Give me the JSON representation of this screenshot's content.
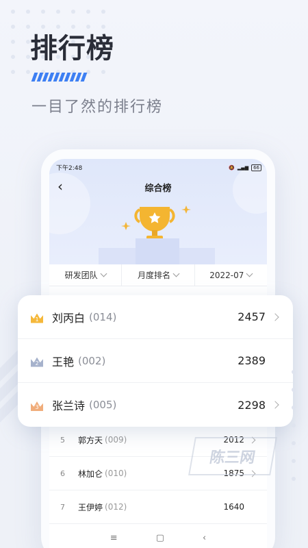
{
  "promo": {
    "title": "排行榜",
    "subtitle": "一目了然的排行榜"
  },
  "status_bar": {
    "time": "下午2:48",
    "battery": "66"
  },
  "nav": {
    "back_icon": "chevron-left-icon",
    "title": "综合榜"
  },
  "filters": [
    {
      "label": "研发团队"
    },
    {
      "label": "月度排名"
    },
    {
      "label": "2022-07"
    }
  ],
  "top_ranks": [
    {
      "rank": "1",
      "name": "刘丙白",
      "code": "(014)",
      "score": "2457",
      "medal_color": "#f5b83a",
      "has_arrow": true
    },
    {
      "rank": "2",
      "name": "王艳",
      "code": "(002)",
      "score": "2389",
      "medal_color": "#a6b2cc",
      "has_arrow": false
    },
    {
      "rank": "3",
      "name": "张兰诗",
      "code": "(005)",
      "score": "2298",
      "medal_color": "#f0ad7b",
      "has_arrow": true
    }
  ],
  "other_ranks": [
    {
      "rank": "5",
      "name": "郭方天",
      "code": "(009)",
      "score": "2012",
      "has_arrow": true
    },
    {
      "rank": "6",
      "name": "林加仑",
      "code": "(010)",
      "score": "1875",
      "has_arrow": true
    },
    {
      "rank": "7",
      "name": "王伊婷",
      "code": "(012)",
      "score": "1640",
      "has_arrow": false
    }
  ],
  "android_nav": {
    "menu": "≡",
    "home": "▢",
    "back": "‹"
  },
  "watermark": "陈三网",
  "colors": {
    "accent": "#3d7ff3",
    "gold": "#f5b83a"
  }
}
